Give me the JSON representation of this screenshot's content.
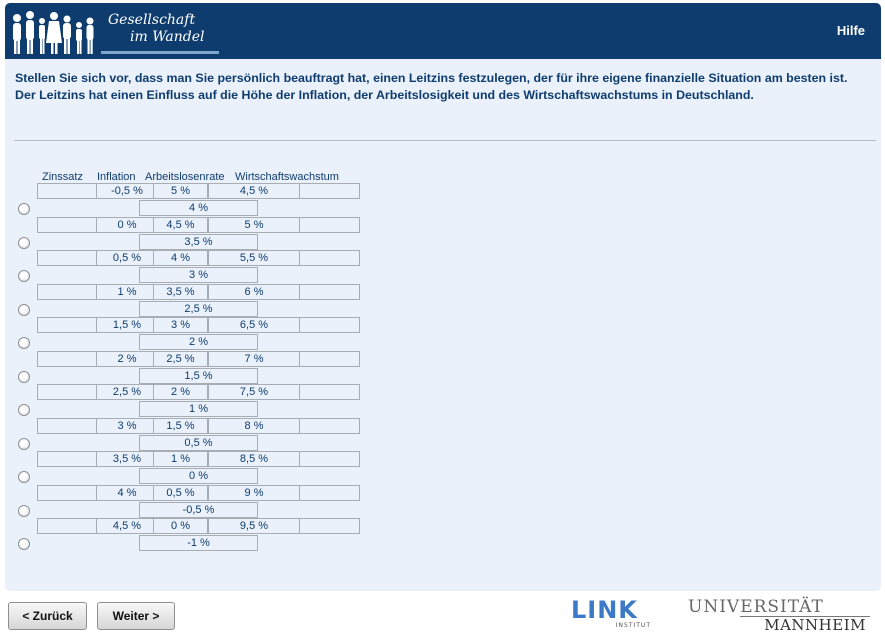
{
  "header": {
    "logo_line1": "Gesellschaft",
    "logo_line2": "im Wandel",
    "help": "Hilfe"
  },
  "question": "Stellen Sie sich vor, dass man Sie persönlich beauftragt hat, einen Leitzins festzulegen, der für ihre eigene finanzielle Situation am besten ist. Der Leitzins hat einen Einfluss auf die Höhe der Inflation, der Arbeitslosigkeit und des Wirtschaftswachstums in Deutschland.",
  "table": {
    "headers": {
      "zinssatz": "Zinssatz",
      "inflation": "Inflation",
      "arbeitslosenrate": "Arbeitslosenrate",
      "wachstum": "Wirtschaftswachstum"
    },
    "options": [
      {
        "inflation": "-0,5 %",
        "arbeitslosenrate": "5 %",
        "wachstum": "4,5 %",
        "zinssatz": "4 %"
      },
      {
        "inflation": "0 %",
        "arbeitslosenrate": "4,5 %",
        "wachstum": "5 %",
        "zinssatz": "3,5 %"
      },
      {
        "inflation": "0,5 %",
        "arbeitslosenrate": "4 %",
        "wachstum": "5,5 %",
        "zinssatz": "3 %"
      },
      {
        "inflation": "1 %",
        "arbeitslosenrate": "3,5 %",
        "wachstum": "6 %",
        "zinssatz": "2,5 %"
      },
      {
        "inflation": "1,5 %",
        "arbeitslosenrate": "3 %",
        "wachstum": "6,5 %",
        "zinssatz": "2 %"
      },
      {
        "inflation": "2 %",
        "arbeitslosenrate": "2,5 %",
        "wachstum": "7 %",
        "zinssatz": "1,5 %"
      },
      {
        "inflation": "2,5 %",
        "arbeitslosenrate": "2 %",
        "wachstum": "7,5 %",
        "zinssatz": "1 %"
      },
      {
        "inflation": "3 %",
        "arbeitslosenrate": "1,5 %",
        "wachstum": "8 %",
        "zinssatz": "0,5 %"
      },
      {
        "inflation": "3,5 %",
        "arbeitslosenrate": "1 %",
        "wachstum": "8,5 %",
        "zinssatz": "0 %"
      },
      {
        "inflation": "4 %",
        "arbeitslosenrate": "0,5 %",
        "wachstum": "9 %",
        "zinssatz": "-0,5 %"
      },
      {
        "inflation": "4,5 %",
        "arbeitslosenrate": "0 %",
        "wachstum": "9,5 %",
        "zinssatz": "-1 %"
      }
    ]
  },
  "nav": {
    "back": "< Zurück",
    "next": "Weiter >"
  },
  "footer": {
    "link_word": "LINK",
    "link_sub": "INSTITUT",
    "uni_line1": "UNIVERSITÄT",
    "uni_line2": "MANNHEIM"
  },
  "colors": {
    "header_bg": "#0e3c6e",
    "content_bg": "#eaf1fb",
    "text": "#0e3c6e"
  }
}
